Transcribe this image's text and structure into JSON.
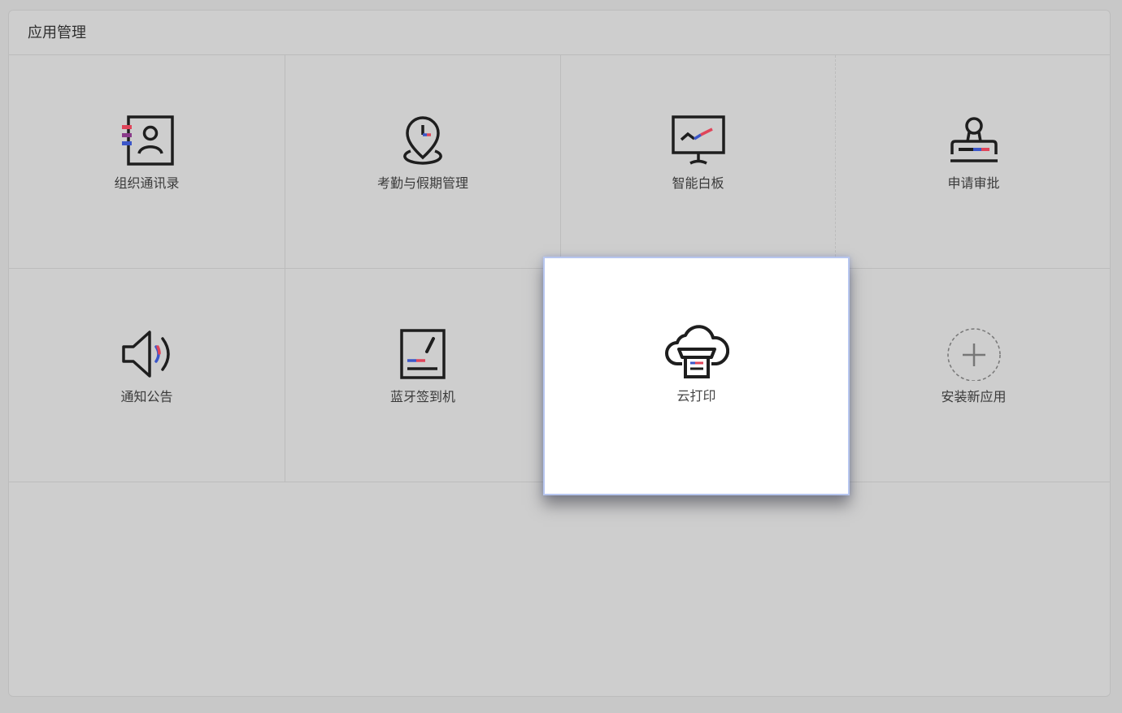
{
  "panel": {
    "title": "应用管理"
  },
  "apps": [
    {
      "label": "组织通讯录",
      "icon": "contact-book-icon"
    },
    {
      "label": "考勤与假期管理",
      "icon": "location-clock-icon"
    },
    {
      "label": "智能白板",
      "icon": "whiteboard-chart-icon"
    },
    {
      "label": "申请审批",
      "icon": "approval-stamp-icon"
    },
    {
      "label": "通知公告",
      "icon": "speaker-icon"
    },
    {
      "label": "蓝牙签到机",
      "icon": "signature-pad-icon"
    },
    {
      "label": "安装新应用",
      "icon": "add-circle-icon"
    }
  ],
  "dragging": {
    "label": "云打印",
    "icon": "cloud-print-icon"
  },
  "colors": {
    "accent_red": "#e0455a",
    "accent_blue": "#3b56c9",
    "icon_stroke": "#1e1e1e"
  }
}
